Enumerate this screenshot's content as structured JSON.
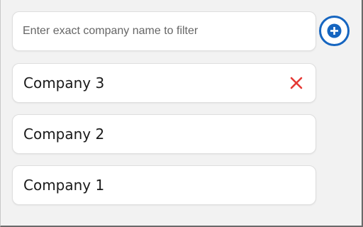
{
  "filter": {
    "placeholder": "Enter exact company name to filter",
    "value": ""
  },
  "add_button": {
    "icon": "plus-circle-icon"
  },
  "companies": [
    {
      "label": "Company 3",
      "removable": true,
      "remove_icon": "close-icon"
    },
    {
      "label": "Company 2",
      "removable": false
    },
    {
      "label": "Company 1",
      "removable": false
    }
  ],
  "colors": {
    "accent": "#1565c0",
    "remove": "#e53935",
    "background": "#f2f2f2",
    "card": "#ffffff"
  }
}
